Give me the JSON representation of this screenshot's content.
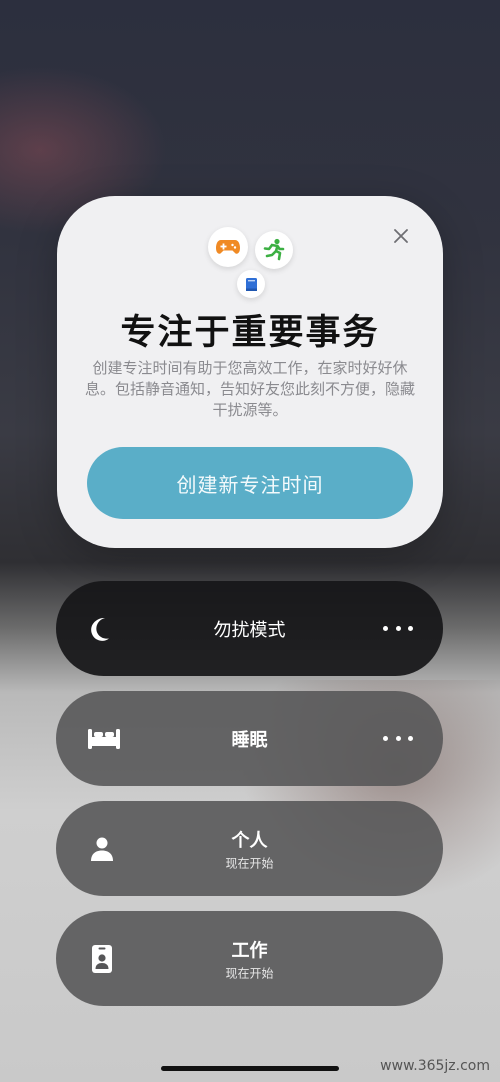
{
  "promo": {
    "title": "专注于重要事务",
    "description": "创建专注时间有助于您高效工作，在家时好好休息。包括静音通知，告知好友您此刻不方便，隐藏干扰源等。",
    "create_button": "创建新专注时间",
    "icons": [
      "close-icon",
      "gamepad-icon",
      "running-icon",
      "book-icon"
    ]
  },
  "modes": [
    {
      "name": "勿扰模式",
      "subtitle": "",
      "icon": "moon-icon",
      "has_more": true
    },
    {
      "name": "睡眠",
      "subtitle": "",
      "icon": "bed-icon",
      "has_more": true
    },
    {
      "name": "个人",
      "subtitle": "现在开始",
      "icon": "person-icon",
      "has_more": false
    },
    {
      "name": "工作",
      "subtitle": "现在开始",
      "icon": "badge-icon",
      "has_more": false
    }
  ],
  "colors": {
    "accent_button": "#5aaec8",
    "game_icon": "#f08a24",
    "run_icon": "#3cb043",
    "book_icon": "#2f6fd6"
  },
  "watermark": "www.365jz.com"
}
